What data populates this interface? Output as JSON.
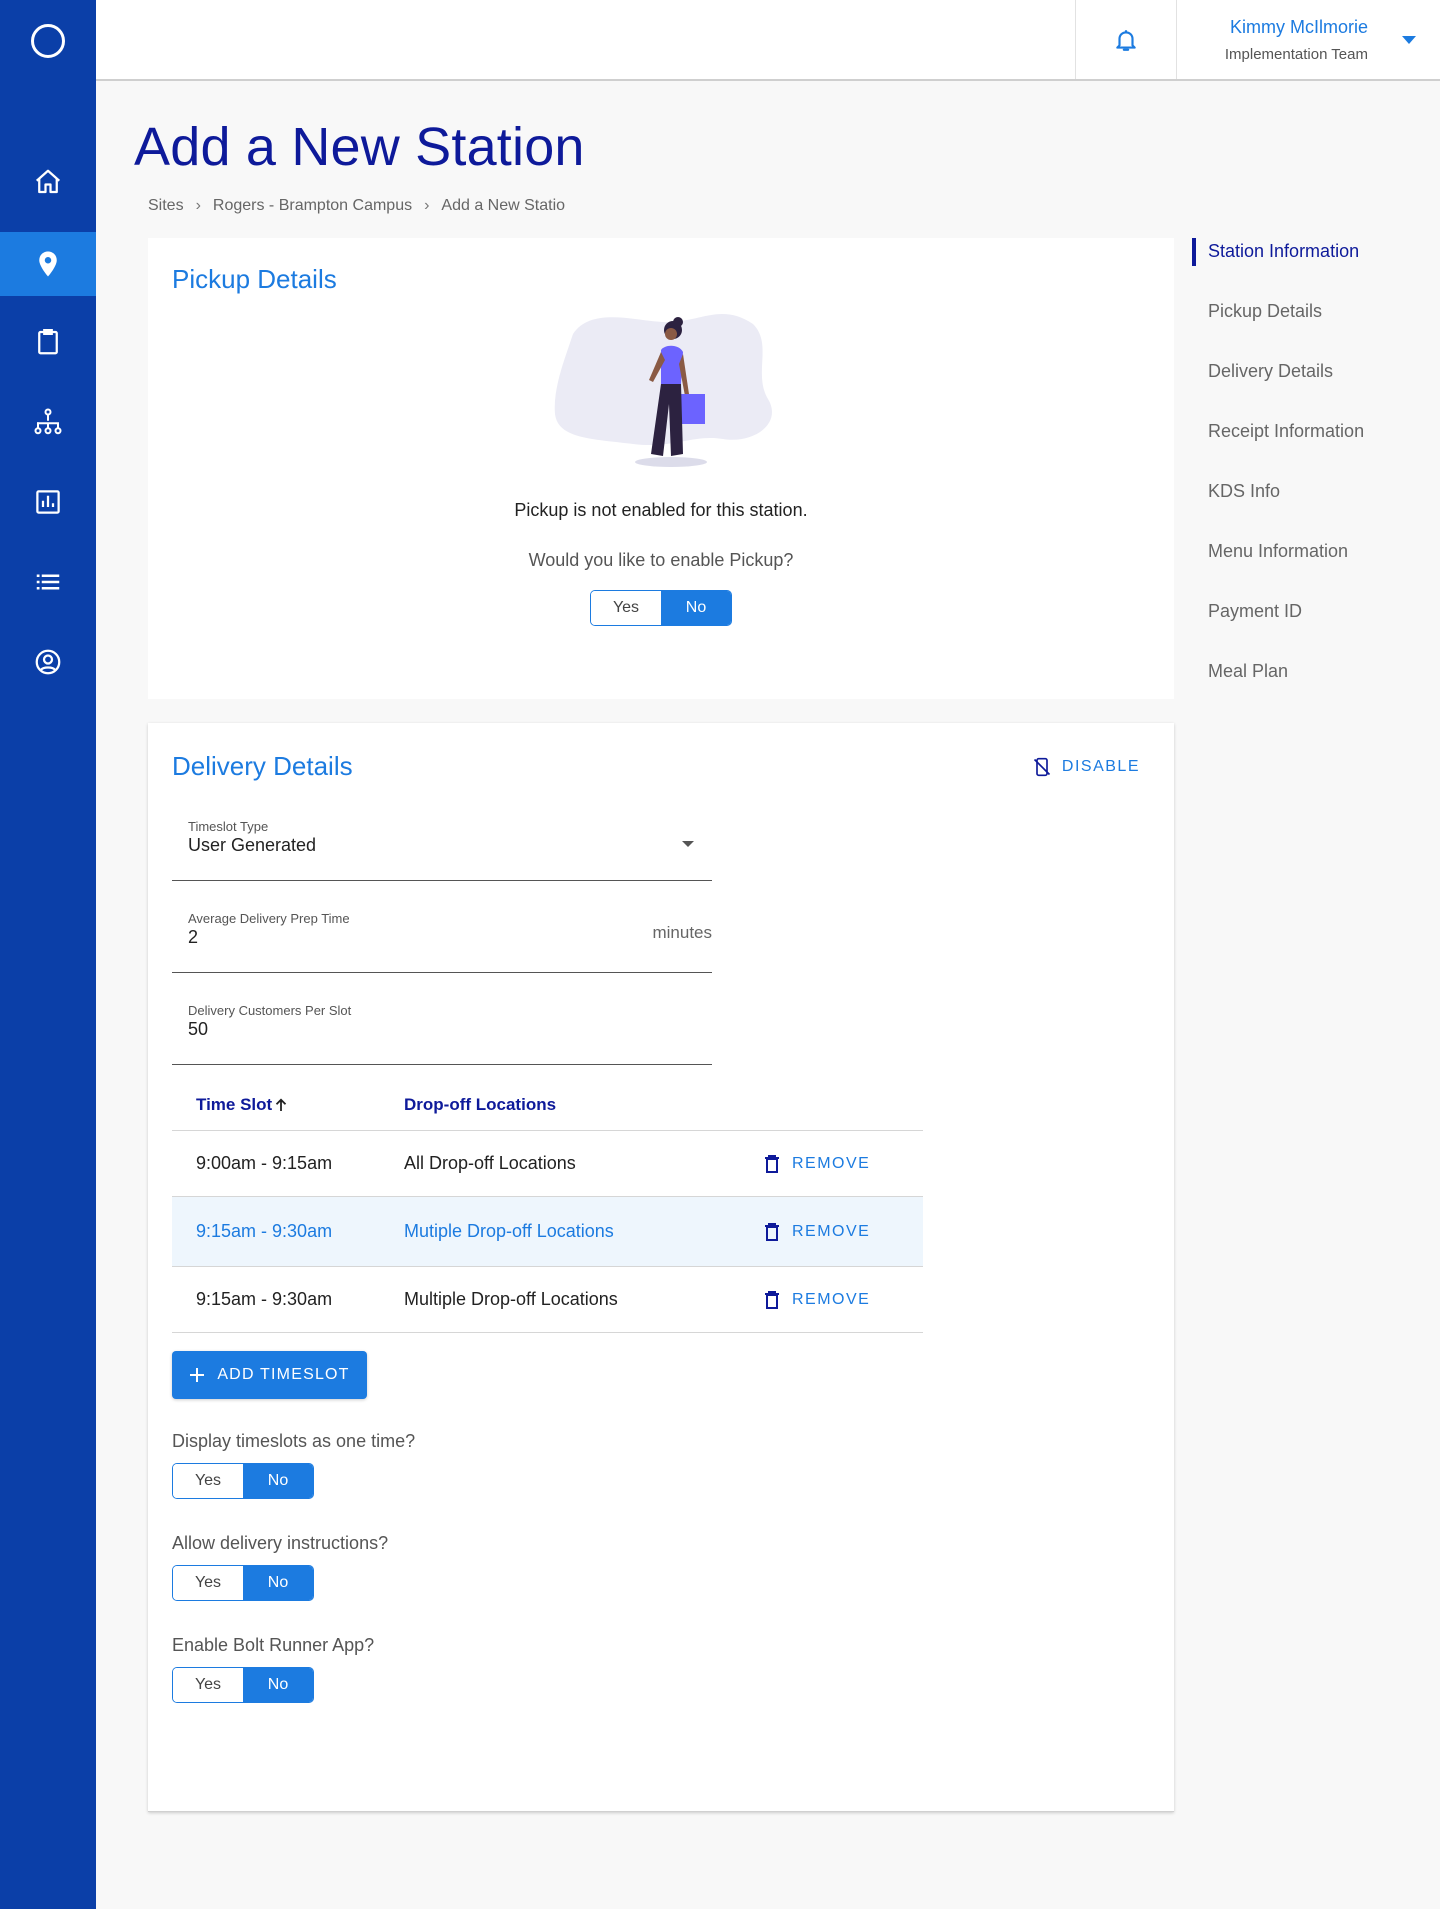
{
  "colors": {
    "sidebar": "#0b3fa8",
    "accent": "#1c7be0",
    "title": "#0e1a9a",
    "row_hover": "#eef6fd"
  },
  "sidebar": {
    "items": [
      {
        "icon": "home-icon"
      },
      {
        "icon": "map-pin-icon",
        "active": true
      },
      {
        "icon": "clipboard-icon"
      },
      {
        "icon": "sitemap-icon"
      },
      {
        "icon": "bar-chart-icon"
      },
      {
        "icon": "list-icon"
      },
      {
        "icon": "user-circle-icon"
      }
    ]
  },
  "header": {
    "user_name": "Kimmy McIlmorie",
    "user_team": "Implementation Team"
  },
  "page": {
    "title": "Add a New Station",
    "breadcrumb": [
      "Sites",
      "Rogers - Brampton Campus",
      "Add a New Statio"
    ]
  },
  "anchor_nav": [
    {
      "label": "Station Information",
      "active": true
    },
    {
      "label": "Pickup Details"
    },
    {
      "label": "Delivery Details"
    },
    {
      "label": "Receipt Information"
    },
    {
      "label": "KDS Info"
    },
    {
      "label": "Menu Information"
    },
    {
      "label": "Payment ID"
    },
    {
      "label": "Meal Plan"
    }
  ],
  "pickup": {
    "title": "Pickup Details",
    "message": "Pickup is not enabled for this station.",
    "question": "Would you like to enable Pickup?",
    "yes": "Yes",
    "no": "No",
    "selected": "No"
  },
  "delivery": {
    "title": "Delivery Details",
    "disable_label": "DISABLE",
    "timeslot_type": {
      "label": "Timeslot Type",
      "value": "User Generated"
    },
    "prep_time": {
      "label": "Average Delivery Prep Time",
      "value": "2",
      "suffix": "minutes"
    },
    "customers": {
      "label": "Delivery Customers Per Slot",
      "value": "50"
    },
    "table": {
      "headers": {
        "time": "Time Slot",
        "locations": "Drop-off Locations"
      },
      "remove_label": "REMOVE",
      "rows": [
        {
          "time": "9:00am - 9:15am",
          "locations": "All Drop-off Locations"
        },
        {
          "time": "9:15am - 9:30am",
          "locations": "Mutiple Drop-off Locations"
        },
        {
          "time": "9:15am - 9:30am",
          "locations": "Multiple Drop-off Locations"
        }
      ]
    },
    "add_timeslot_label": "ADD TIMESLOT",
    "questions": [
      {
        "label": "Display timeslots as one time?",
        "yes": "Yes",
        "no": "No",
        "selected": "No"
      },
      {
        "label": "Allow delivery instructions?",
        "yes": "Yes",
        "no": "No",
        "selected": "No"
      },
      {
        "label": "Enable Bolt Runner App?",
        "yes": "Yes",
        "no": "No",
        "selected": "No"
      }
    ]
  }
}
